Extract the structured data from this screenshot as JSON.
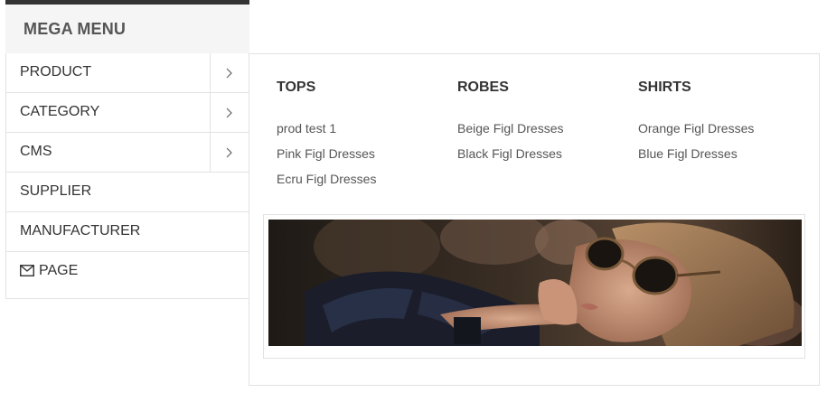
{
  "header": {
    "title": "MEGA MENU"
  },
  "menu": {
    "items": [
      {
        "label": "PRODUCT"
      },
      {
        "label": "CATEGORY"
      },
      {
        "label": "CMS"
      },
      {
        "label": "SUPPLIER"
      },
      {
        "label": "MANUFACTURER"
      },
      {
        "label": "PAGE"
      }
    ]
  },
  "panel": {
    "columns": [
      {
        "title": "TOPS",
        "links": [
          "prod test 1",
          "Pink Figl Dresses",
          "Ecru Figl Dresses"
        ]
      },
      {
        "title": "ROBES",
        "links": [
          "Beige Figl Dresses",
          "Black Figl Dresses"
        ]
      },
      {
        "title": "SHIRTS",
        "links": [
          "Orange Figl Dresses",
          "Blue Figl Dresses"
        ]
      }
    ],
    "banner": {
      "subject": "woman-with-sunglasses-photo"
    }
  },
  "colors": {
    "header_border": "#333333",
    "header_bg": "#f5f5f5",
    "text": "#333333",
    "link": "#555555",
    "border": "#e2e2e2"
  },
  "icons": {
    "submenu_arrow": "chevron-right-icon",
    "page_icon": "envelope-icon"
  }
}
